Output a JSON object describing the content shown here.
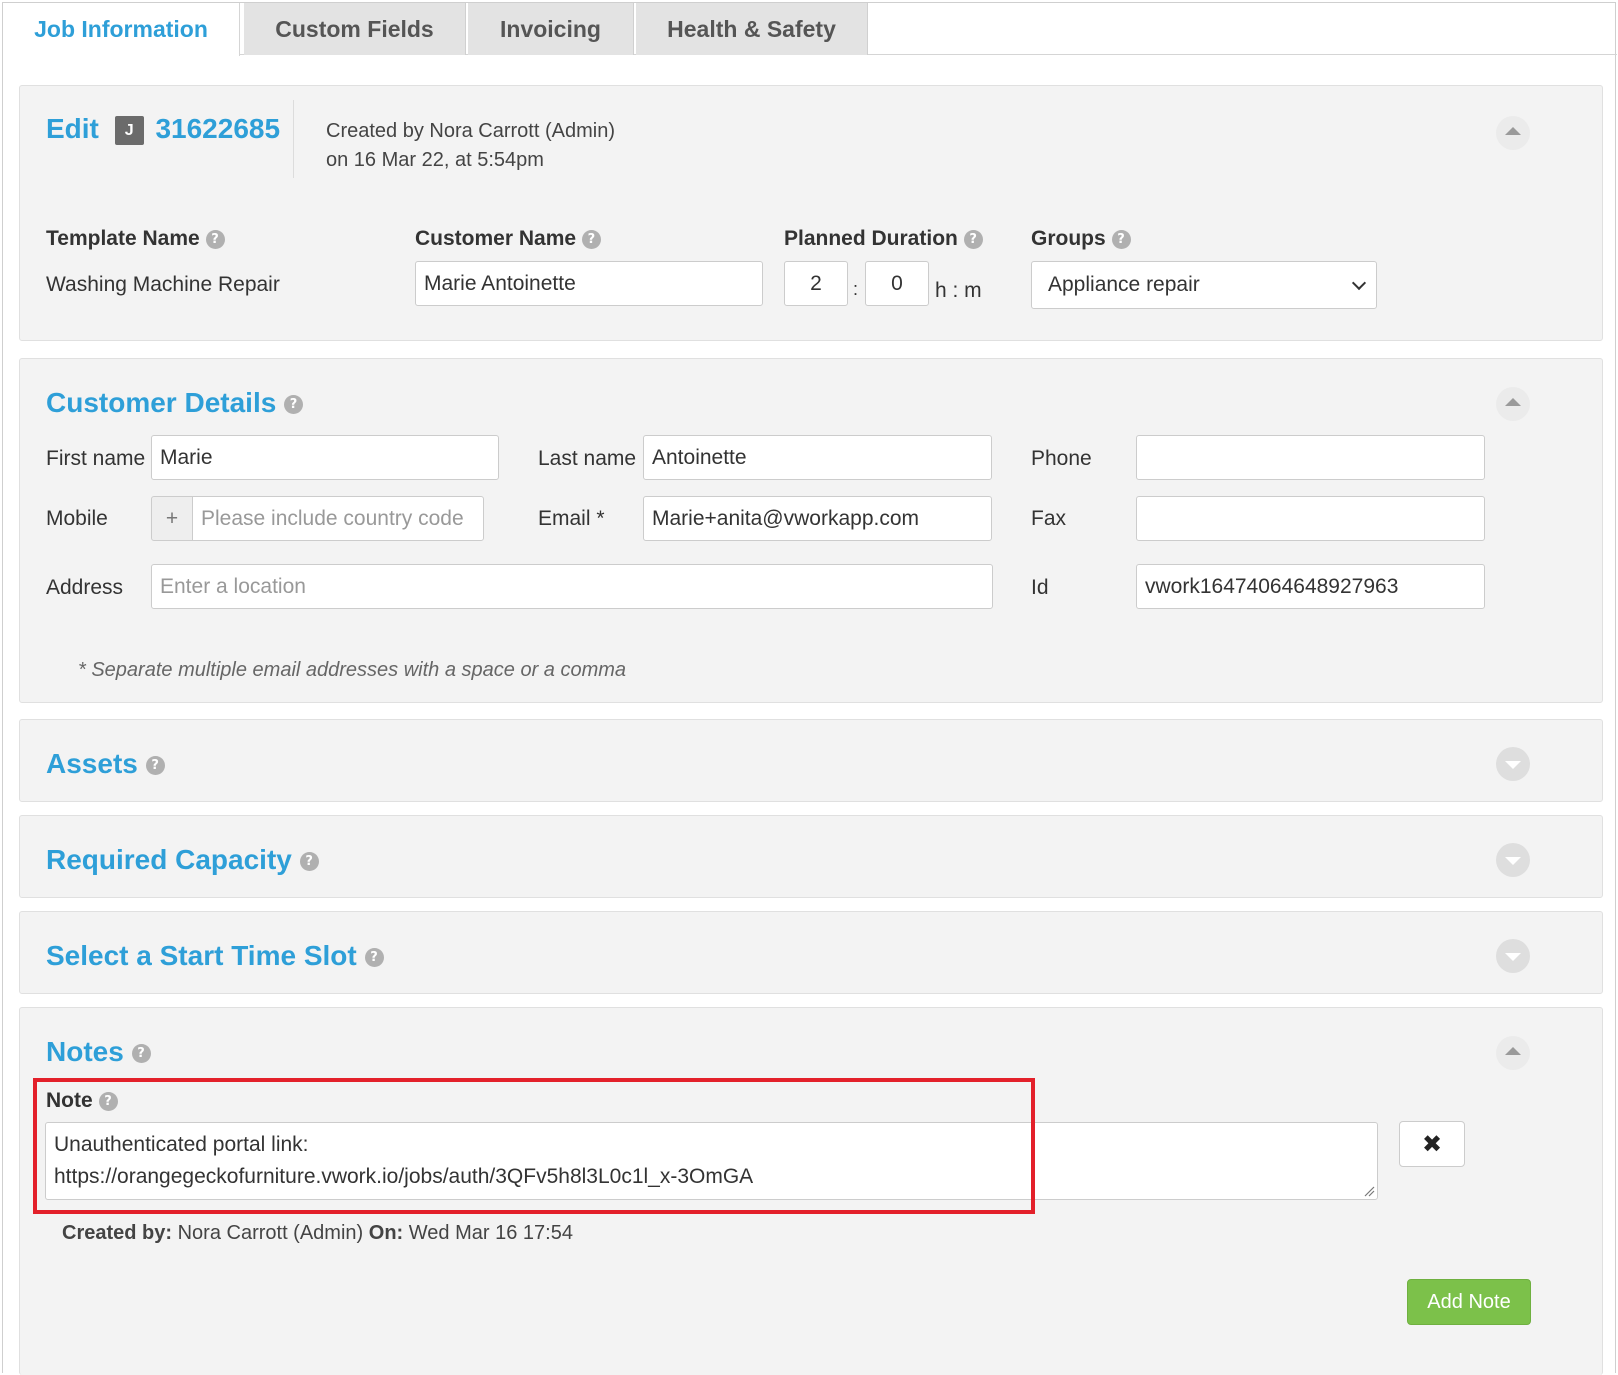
{
  "tabs": [
    "Job Information",
    "Custom Fields",
    "Invoicing",
    "Health & Safety"
  ],
  "edit": {
    "title": "Edit",
    "badge": "J",
    "job_number": "31622685",
    "created_line1": "Created by Nora Carrott (Admin)",
    "created_line2": "on 16 Mar 22, at 5:54pm",
    "template_label": "Template Name",
    "template_value": "Washing Machine Repair",
    "customer_label": "Customer Name",
    "customer_value": "Marie Antoinette",
    "duration_label": "Planned Duration",
    "duration_hours": "2",
    "duration_minutes": "0",
    "duration_sep": ":",
    "duration_unit": "h : m",
    "groups_label": "Groups",
    "groups_value": "Appliance repair"
  },
  "customer_details": {
    "title": "Customer Details",
    "first_name_label": "First name",
    "first_name_value": "Marie",
    "last_name_label": "Last name",
    "last_name_value": "Antoinette",
    "phone_label": "Phone",
    "mobile_label": "Mobile",
    "mobile_prefix": "+",
    "mobile_placeholder": "Please include country code",
    "email_label": "Email *",
    "email_value": "Marie+anita@vworkapp.com",
    "fax_label": "Fax",
    "address_label": "Address",
    "address_placeholder": "Enter a location",
    "id_label": "Id",
    "id_value": "vwork16474064648927963",
    "footnote": "* Separate multiple email addresses with a space or a comma"
  },
  "sections": {
    "assets": "Assets",
    "required_capacity": "Required Capacity",
    "start_time_slot": "Select a Start Time Slot"
  },
  "notes": {
    "title": "Notes",
    "note_label": "Note",
    "note_line1": "Unauthenticated portal link:",
    "note_line2": "https://orangegeckofurniture.vwork.io/jobs/auth/3QFv5h8l3L0c1l_x-3OmGA",
    "created_by_label": "Created by:",
    "created_by_value": "Nora Carrott (Admin)",
    "on_label": "On:",
    "on_value": "Wed Mar 16 17:54",
    "add_note_label": "Add Note"
  },
  "help_glyph": "?",
  "colors": {
    "accent": "#2e9fd8",
    "add_button": "#7cc14a",
    "highlight": "#e3202a"
  }
}
